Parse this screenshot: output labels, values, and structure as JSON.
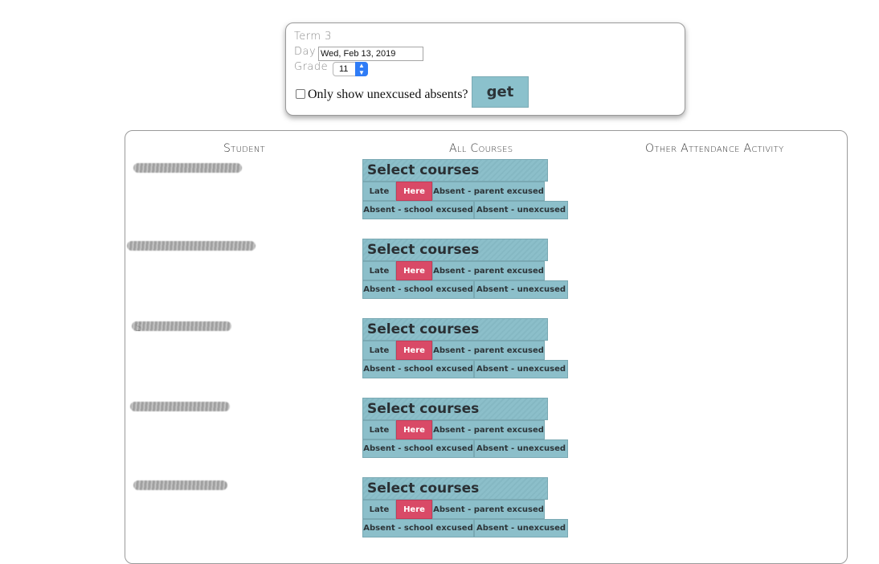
{
  "filters": {
    "term_label": "Term 3",
    "day_label": "Day",
    "date_value": "Wed, Feb 13, 2019",
    "grade_label": "Grade",
    "grade_value": "11",
    "unexcused_label": "Only show unexcused absents?",
    "get_label": "get"
  },
  "table": {
    "headers": [
      "Student",
      "All Courses",
      "Other Attendance Activity"
    ],
    "select_courses_label": "Select courses",
    "buttons": {
      "late": "Late",
      "here": "Here",
      "absent_parent": "Absent - parent excused",
      "absent_school": "Absent - school excused",
      "absent_unexcused": "Absent - unexcused"
    },
    "selected_status": "Here",
    "students": [
      {
        "visible_name": "",
        "redacted": true
      },
      {
        "visible_name": "",
        "redacted": true
      },
      {
        "visible_name": "S",
        "redacted": true
      },
      {
        "visible_name": "",
        "redacted": true
      },
      {
        "visible_name": "",
        "redacted": true
      }
    ]
  },
  "colors": {
    "button_bg": "#8cbfca",
    "selected_bg": "#d94a67",
    "accent_select": "#2f7cf6"
  }
}
